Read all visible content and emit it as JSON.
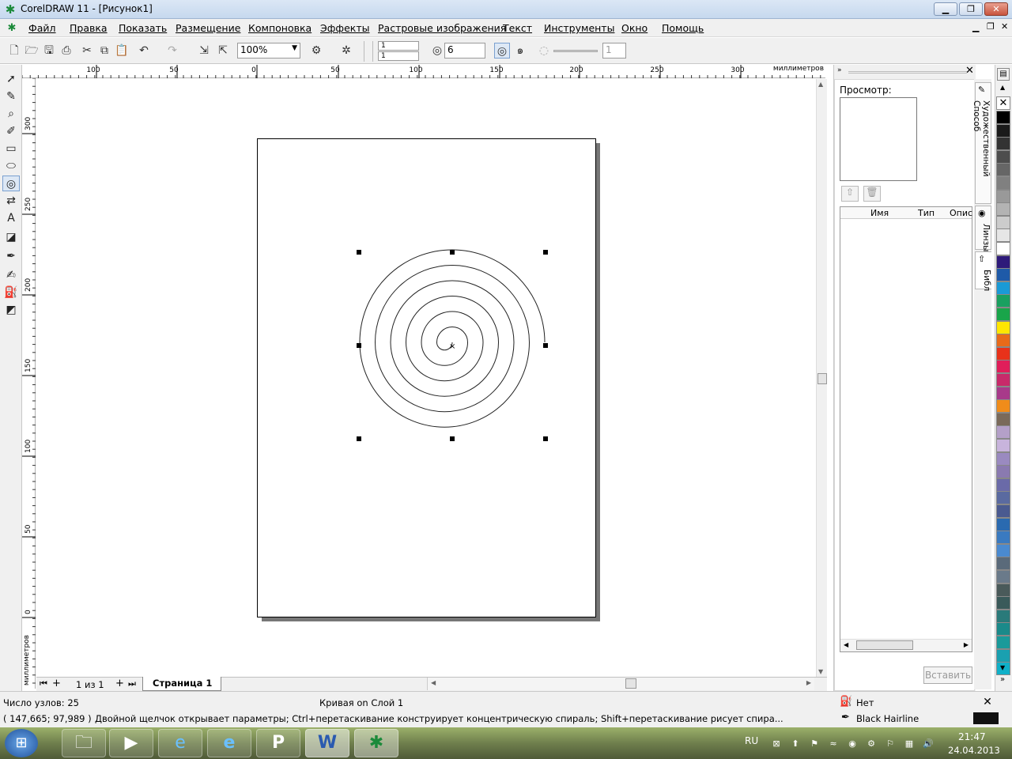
{
  "window": {
    "title": "CorelDRAW 11 - [Рисунок1]",
    "app_icon": "coreldraw-icon"
  },
  "menu": [
    "Файл",
    "Правка",
    "Показать",
    "Размещение",
    "Компоновка",
    "Эффекты",
    "Растровые изображения",
    "Текст",
    "Инструменты",
    "Окно",
    "Помощь"
  ],
  "toolbar": {
    "zoom_value": "100%",
    "spiral_revolutions": "6",
    "object_count_a": "1",
    "object_count_b": "1",
    "expansion_value": "1"
  },
  "ruler": {
    "units": "миллиметров",
    "h_ticks": [
      "100",
      "50",
      "0",
      "50",
      "100",
      "150",
      "200",
      "250",
      "300"
    ],
    "v_ticks": [
      "300",
      "250",
      "200",
      "150",
      "100",
      "50",
      "0"
    ]
  },
  "pages": {
    "counter": "1 из 1",
    "tab": "Страница 1"
  },
  "docker": {
    "preview_label": "Просмотр:",
    "col_name": "Имя",
    "col_type": "Тип",
    "col_desc": "Опис",
    "insert_button": "Вставить",
    "tab_artistic": "Художественный Способ",
    "tab_lens": "Линзы",
    "tab_library": "Библ"
  },
  "palette": {
    "colors": [
      "#000000",
      "#1a1a1a",
      "#333333",
      "#4d4d4d",
      "#666666",
      "#808080",
      "#999999",
      "#b3b3b3",
      "#cccccc",
      "#e6e6e6",
      "#ffffff",
      "#2e1a7a",
      "#1e5aa8",
      "#1a9ad6",
      "#1aa060",
      "#19a54a",
      "#ffe600",
      "#e86a1a",
      "#e8321a",
      "#e01e5a",
      "#c82a6a",
      "#a83a8a",
      "#f08c1a",
      "#7a6a5a",
      "#b4a0c8",
      "#c8b4dc",
      "#9a8ac0",
      "#8a7ab0",
      "#6a6aa8",
      "#5a6aa0",
      "#4a5a90",
      "#2a6ab0",
      "#3a7ac0",
      "#4a8ad0",
      "#5a6a7a",
      "#6a7a8a",
      "#4a5a5a",
      "#3a5a5a",
      "#2a7a7a",
      "#1a8a8a",
      "#1a9a9a",
      "#1aa0b0",
      "#10b0c8"
    ]
  },
  "status": {
    "nodes": "Число узлов: 25",
    "layer": "Кривая on Слой 1",
    "coords": "( 147,665; 97,989 )",
    "hint": "Двойной щелчок открывает параметры; Ctrl+перетаскивание конструирует концентрическую спираль; Shift+перетаскивание рисует спира...",
    "fill": "Нет",
    "outline": "Black  Hairline"
  },
  "taskbar": {
    "lang": "RU",
    "time": "21:47",
    "date": "24.04.2013"
  }
}
